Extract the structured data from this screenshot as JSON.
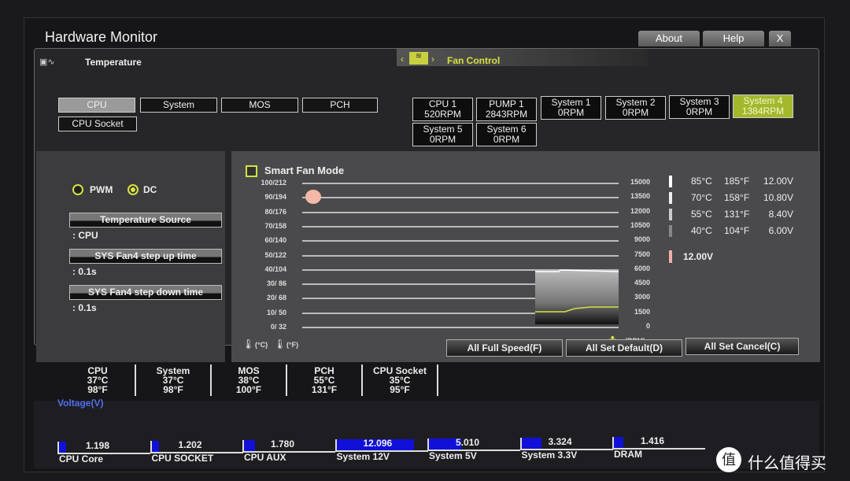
{
  "window": {
    "title": "Hardware Monitor",
    "about": "About",
    "help": "Help",
    "close": "X"
  },
  "temperature": {
    "header": "Temperature",
    "tabs": [
      "CPU",
      "System",
      "MOS",
      "PCH",
      "CPU Socket"
    ],
    "selected": "CPU"
  },
  "fan_control": {
    "header": "Fan Control",
    "fans": [
      {
        "name": "CPU 1",
        "rpm": "520RPM"
      },
      {
        "name": "PUMP 1",
        "rpm": "2843RPM"
      },
      {
        "name": "System 1",
        "rpm": "0RPM"
      },
      {
        "name": "System 2",
        "rpm": "0RPM"
      },
      {
        "name": "System 3",
        "rpm": "0RPM"
      },
      {
        "name": "System 4",
        "rpm": "1384RPM",
        "selected": true
      },
      {
        "name": "System 5",
        "rpm": "0RPM"
      },
      {
        "name": "System 6",
        "rpm": "0RPM"
      }
    ]
  },
  "settings": {
    "pwm": "PWM",
    "dc": "DC",
    "mode_selected": "DC",
    "temp_source_label": "Temperature Source",
    "temp_source_value": ": CPU",
    "step_up_label": "SYS Fan4 step up time",
    "step_up_value": ": 0.1s",
    "step_down_label": "SYS Fan4 step down time",
    "step_down_value": ": 0.1s"
  },
  "chart": {
    "smart_fan_mode": "Smart Fan Mode",
    "smart_fan_checked": false,
    "left_ticks": [
      "100/212",
      "90/194",
      "80/176",
      "70/158",
      "60/140",
      "50/122",
      "40/104",
      "30/ 86",
      "20/ 68",
      "10/ 50",
      "0/ 32"
    ],
    "right_ticks": [
      "15000",
      "13500",
      "12000",
      "10500",
      "9000",
      "7500",
      "6000",
      "4500",
      "3000",
      "1500",
      "0"
    ],
    "unit_c": "(°C)",
    "unit_f": "(°F)",
    "unit_rpm": "(RPM)",
    "point_temp_c": 90,
    "legend": [
      {
        "c": "85°C",
        "f": "185°F",
        "v": "12.00V",
        "color": "#ffffff"
      },
      {
        "c": "70°C",
        "f": "158°F",
        "v": "10.80V",
        "color": "#eeeeee"
      },
      {
        "c": "55°C",
        "f": "131°F",
        "v": "8.40V",
        "color": "#cccccc"
      },
      {
        "c": "40°C",
        "f": "104°F",
        "v": "6.00V",
        "color": "#888888"
      }
    ],
    "current": {
      "v": "12.00V",
      "color": "#f0b0a8"
    }
  },
  "actions": {
    "full_speed": "All Full Speed(F)",
    "set_default": "All Set Default(D)",
    "set_cancel": "All Set Cancel(C)"
  },
  "temps": [
    {
      "name": "CPU",
      "c": "37°C",
      "f": "98°F"
    },
    {
      "name": "System",
      "c": "37°C",
      "f": "98°F"
    },
    {
      "name": "MOS",
      "c": "38°C",
      "f": "100°F"
    },
    {
      "name": "PCH",
      "c": "55°C",
      "f": "131°F"
    },
    {
      "name": "CPU Socket",
      "c": "35°C",
      "f": "95°F"
    }
  ],
  "voltage": {
    "title": "Voltage(V)",
    "items": [
      {
        "name": "CPU Core",
        "value": "1.198",
        "fill": 0.08
      },
      {
        "name": "CPU SOCKET",
        "value": "1.202",
        "fill": 0.08
      },
      {
        "name": "CPU AUX",
        "value": "1.780",
        "fill": 0.12
      },
      {
        "name": "System 12V",
        "value": "12.096",
        "fill": 0.85
      },
      {
        "name": "System 5V",
        "value": "5.010",
        "fill": 0.35
      },
      {
        "name": "System 3.3V",
        "value": "3.324",
        "fill": 0.22
      },
      {
        "name": "DRAM",
        "value": "1.416",
        "fill": 0.1
      }
    ]
  },
  "watermark": "什么值得买"
}
